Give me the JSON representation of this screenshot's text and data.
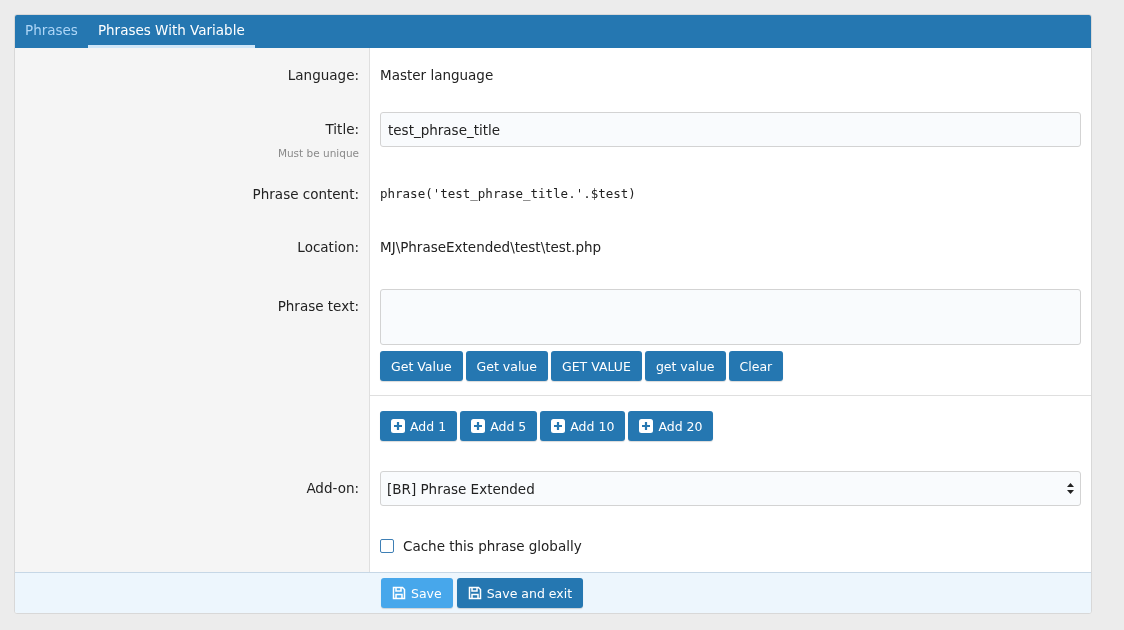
{
  "tabs": [
    {
      "label": "Phrases",
      "selected": false
    },
    {
      "label": "Phrases With Variable",
      "selected": true
    }
  ],
  "rows": [
    {
      "kind": "text",
      "label": "Language:",
      "value": "Master language"
    },
    {
      "kind": "input",
      "label": "Title:",
      "hint": "Must be unique",
      "value": "test_phrase_title"
    },
    {
      "kind": "code",
      "label": "Phrase content:",
      "value": "phrase('test_phrase_title.'.$test)"
    },
    {
      "kind": "text",
      "label": "Location:",
      "value": "MJ\\PhraseExtended\\test\\test.php"
    },
    {
      "kind": "textarea",
      "label": "Phrase text:",
      "buttons": [
        "Get Value",
        "Get value",
        "GET VALUE",
        "get value",
        "Clear"
      ]
    },
    {
      "kind": "add_buttons",
      "buttons": [
        "Add 1",
        "Add 5",
        "Add 10",
        "Add 20"
      ]
    },
    {
      "kind": "select",
      "label": "Add-on:",
      "value": "[BR] Phrase Extended"
    },
    {
      "kind": "checkbox",
      "text": "Cache this phrase globally",
      "checked": false
    }
  ],
  "footer": {
    "buttons": [
      {
        "label": "Save",
        "kind": "primary"
      },
      {
        "label": "Save and exit",
        "kind": "secondary"
      }
    ]
  }
}
